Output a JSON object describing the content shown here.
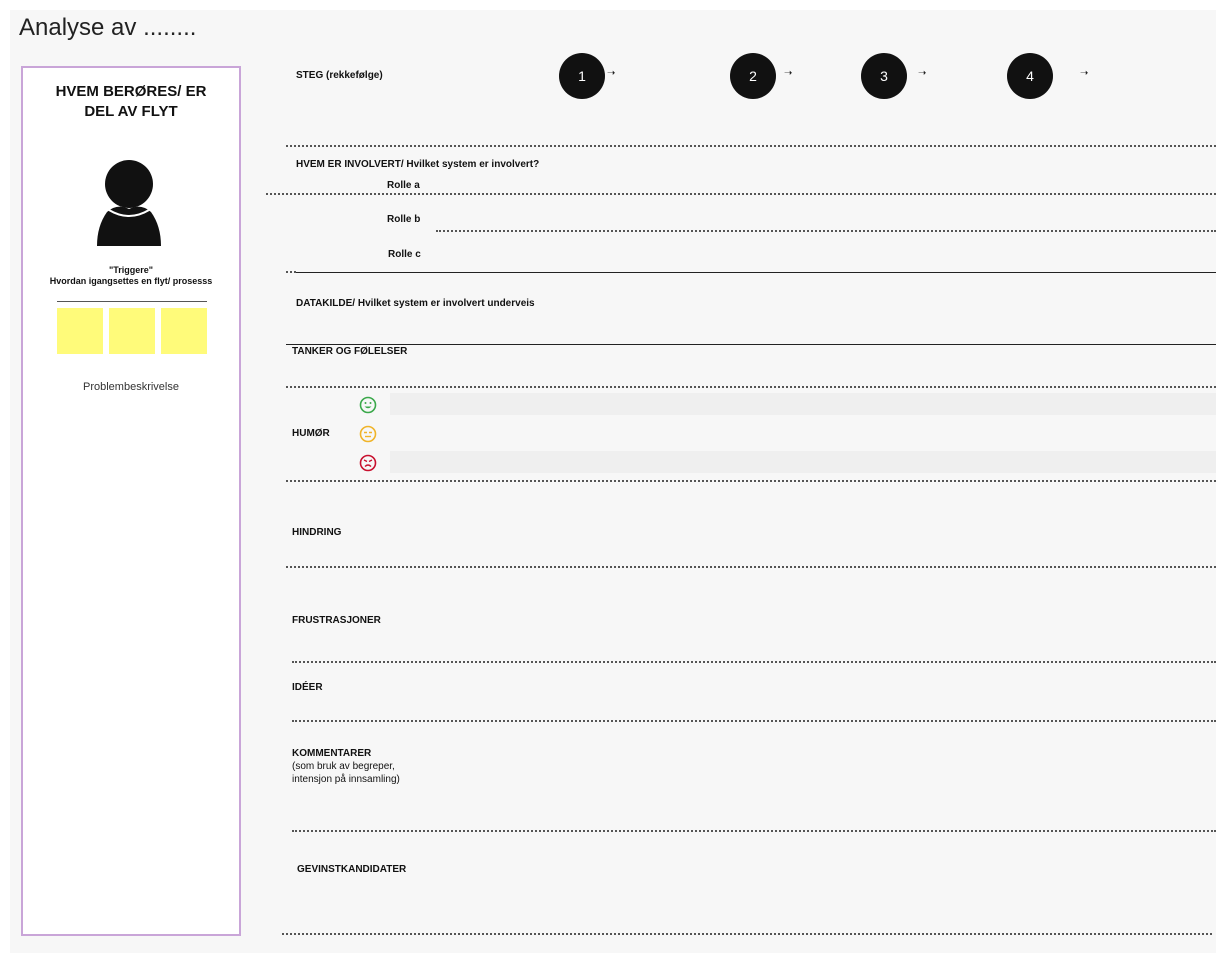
{
  "title": "Analyse av ........",
  "persona": {
    "heading": "HVEM BERØRES/ ER\nDEL AV FLYT",
    "trigger_title": "\"Triggere\"",
    "trigger_subtitle": "Hvordan igangsettes en flyt/ prosesss",
    "problem": "Problembeskrivelse",
    "note_color": "#fffb7a",
    "border_color": "#c9a5d8"
  },
  "steps": {
    "label": "STEG (rekkefølge)",
    "items": [
      "1",
      "2",
      "3",
      "4"
    ],
    "arrow": "➝"
  },
  "involved": {
    "label": "HVEM ER INVOLVERT/ Hvilket system er involvert?",
    "roles": [
      "Rolle a",
      "Rolle b",
      "Rolle c"
    ]
  },
  "datasource": {
    "label": "DATAKILDE/ Hvilket system er involvert underveis"
  },
  "feelings": {
    "label": "TANKER OG FØLELSER"
  },
  "mood": {
    "label": "HUMØR",
    "icons": [
      "happy-face-icon",
      "neutral-face-icon",
      "sad-face-icon"
    ],
    "colors": [
      "#3aa84a",
      "#f0b429",
      "#c8102e"
    ]
  },
  "obstacle": {
    "label": "HINDRING"
  },
  "frustrations": {
    "label": "FRUSTRASJONER"
  },
  "ideas": {
    "label": "IDÉER"
  },
  "comments": {
    "label": "KOMMENTARER",
    "note_line1": "(som bruk av begreper,",
    "note_line2": "intensjon på innsamling)"
  },
  "gains": {
    "label": "GEVINSTKANDIDATER"
  }
}
